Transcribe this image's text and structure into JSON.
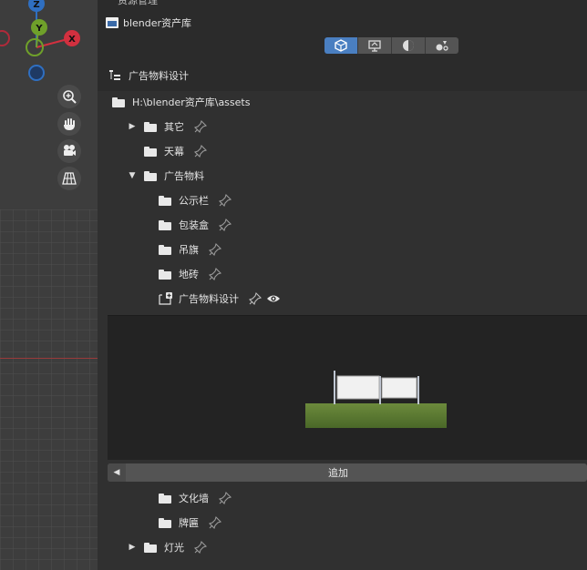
{
  "viewport": {
    "gizmo": {
      "z_label": "Z",
      "y_label": "Y",
      "x_label": "X"
    },
    "nav_buttons": [
      "zoom-icon",
      "pan-hand-icon",
      "camera-icon",
      "grid-view-icon"
    ]
  },
  "panel": {
    "top_cut_label": "资源管理",
    "library_name": "blender资产库",
    "modes": [
      "object-mode-icon",
      "scene-icon",
      "material-icon",
      "world-icon"
    ],
    "catalog_title": "广告物料设计",
    "root_path": "H:\\blender资产库\\assets",
    "tree": [
      {
        "label": "其它"
      },
      {
        "label": "天幕"
      },
      {
        "label": "广告物料"
      },
      {
        "label": "公示栏"
      },
      {
        "label": "包装盒"
      },
      {
        "label": "吊旗"
      },
      {
        "label": "地砖"
      },
      {
        "label": "广告物料设计"
      }
    ],
    "add_label": "追加",
    "tree_after": [
      {
        "label": "文化墙"
      },
      {
        "label": "牌匾"
      },
      {
        "label": "灯光"
      }
    ]
  },
  "colors": {
    "accent": "#4a7fc1",
    "axis_x": "#d2303f",
    "axis_y": "#6fa02a",
    "axis_z": "#2f6fc1"
  }
}
